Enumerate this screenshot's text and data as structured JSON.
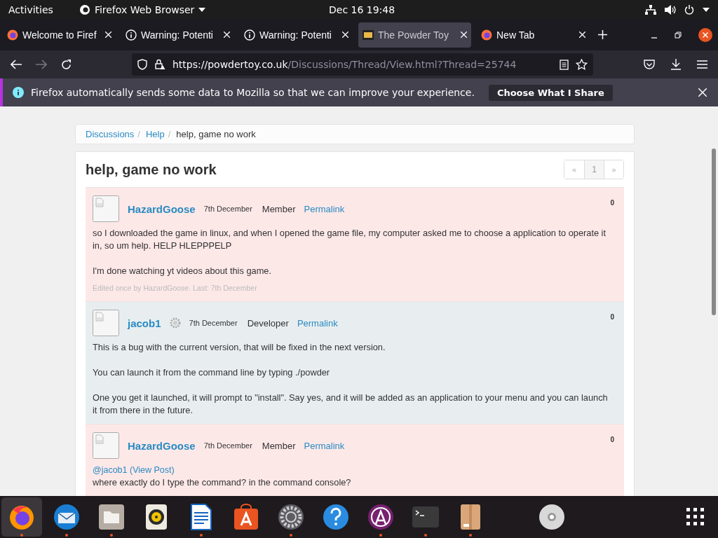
{
  "top_bar": {
    "activities": "Activities",
    "app_menu": "Firefox Web Browser",
    "clock": "Dec 16  19:48"
  },
  "tabs": [
    {
      "title": "Welcome to Firef",
      "selected": false
    },
    {
      "title": "Warning: Potenti",
      "selected": false
    },
    {
      "title": "Warning: Potenti",
      "selected": false
    },
    {
      "title": "The Powder Toy",
      "selected": true
    },
    {
      "title": "New Tab",
      "selected": false
    }
  ],
  "address_bar": {
    "host": "https://powdertoy.co.uk",
    "path": "/Discussions/Thread/View.html?Thread=25744"
  },
  "notification": {
    "message": "Firefox automatically sends some data to Mozilla so that we can improve your experience.",
    "button": "Choose What I Share"
  },
  "breadcrumb": {
    "links": [
      "Discussions",
      "Help"
    ],
    "separator": "/",
    "current": "help, game no work"
  },
  "thread": {
    "title": "help, game no work",
    "pagination": [
      "«",
      "1",
      "»"
    ],
    "posts": [
      {
        "kind": "member",
        "author": "HazardGoose",
        "date": "7th December",
        "role": "Member",
        "permalink": "Permalink",
        "score": "0",
        "paragraphs": [
          "so I downloaded the game in linux, and when I opened the game file, my computer asked me to choose a application to operate it in, so um help. HELP HLEPPPELP",
          "I'm done watching yt videos about this game."
        ],
        "edited": "Edited once by HazardGoose. Last: 7th December"
      },
      {
        "kind": "developer",
        "author": "jacob1",
        "date": "7th December",
        "role": "Developer",
        "permalink": "Permalink",
        "score": "0",
        "paragraphs": [
          "This is a bug with the current version, that will be fixed in the next version.",
          "You can launch it from the command line by typing ./powder",
          "One you get it launched, it will prompt to \"install\". Say yes, and it will be added as an application to your menu and you can launch it from there in the future."
        ]
      },
      {
        "kind": "member",
        "author": "HazardGoose",
        "date": "7th December",
        "role": "Member",
        "permalink": "Permalink",
        "score": "0",
        "quote": "@jacob1 (View Post)",
        "paragraphs": [
          " where exactly do I type the command? in the command console?"
        ]
      }
    ]
  },
  "dock": [
    {
      "running": true,
      "selected": true
    },
    {
      "running": true,
      "selected": false
    },
    {
      "running": true,
      "selected": false
    },
    {
      "running": false,
      "selected": false
    },
    {
      "running": true,
      "selected": false
    },
    {
      "running": false,
      "selected": false
    },
    {
      "running": true,
      "selected": false
    },
    {
      "running": false,
      "selected": false
    },
    {
      "running": true,
      "selected": false
    },
    {
      "running": true,
      "selected": false
    },
    {
      "running": true,
      "selected": false
    },
    {
      "running": false,
      "selected": false
    }
  ]
}
